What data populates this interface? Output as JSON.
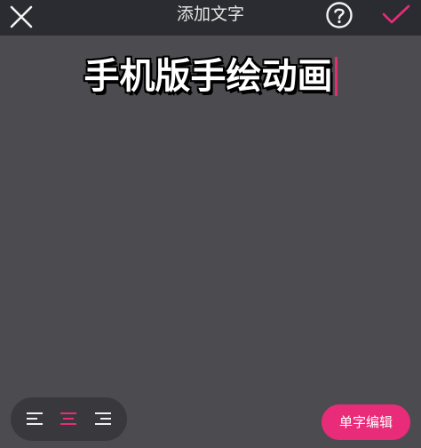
{
  "header": {
    "title": "添加文字",
    "close_icon": "close-icon",
    "help_icon": "help-circle-icon",
    "confirm_icon": "checkmark-icon"
  },
  "editor": {
    "text": "手机版手绘动画",
    "text_color": "#ffffff",
    "outline_color": "#000000",
    "caret_color": "#e52b72"
  },
  "alignment": {
    "options": [
      "left",
      "center",
      "right"
    ],
    "selected": "center"
  },
  "actions": {
    "char_edit_label": "单字编辑"
  },
  "colors": {
    "accent": "#e92c79",
    "topbar_bg": "#2b2c31",
    "canvas_bg": "#4c4c50",
    "pill_bg": "#38383d"
  }
}
